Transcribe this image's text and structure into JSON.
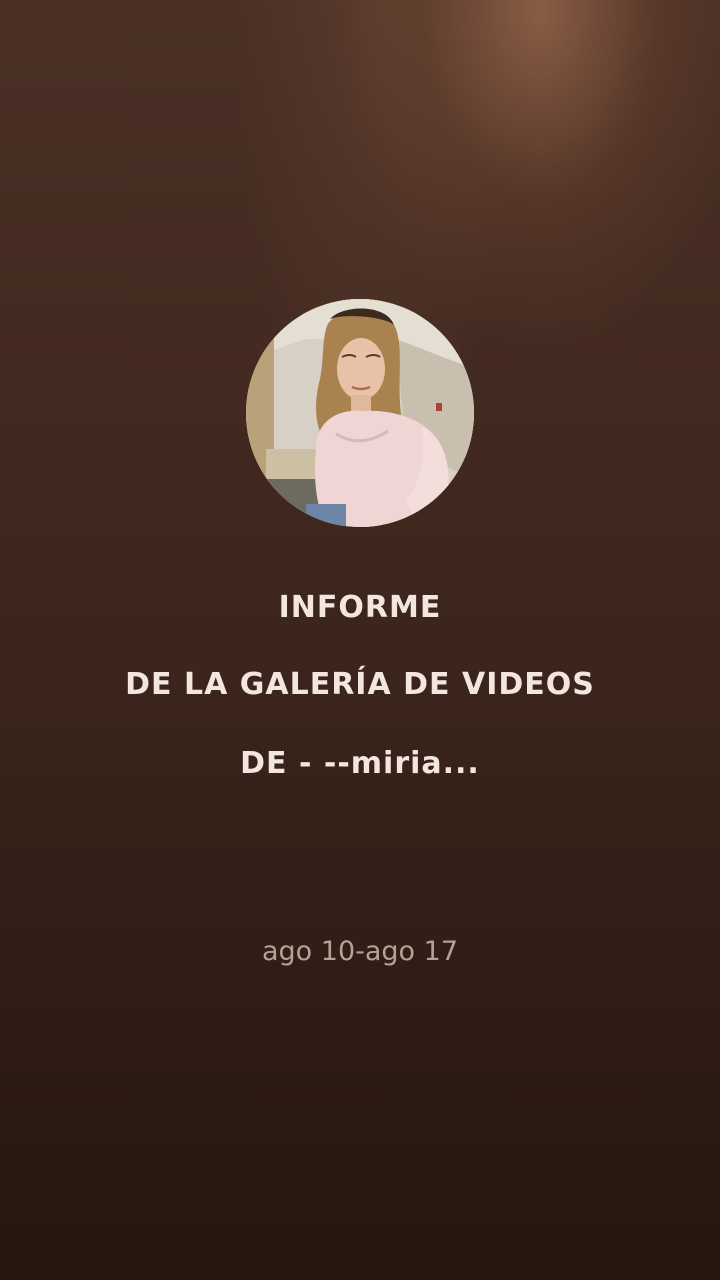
{
  "report": {
    "title_line_1": "INFORME",
    "title_line_2": "DE LA GALERÍA DE VIDEOS",
    "title_line_3": "DE - --miria...",
    "date_range": "ago 10-ago 17"
  },
  "colors": {
    "title_text": "#f3e6df",
    "date_text": "#b7a096",
    "background_top": "#4a3025",
    "background_bottom": "#26160f"
  }
}
